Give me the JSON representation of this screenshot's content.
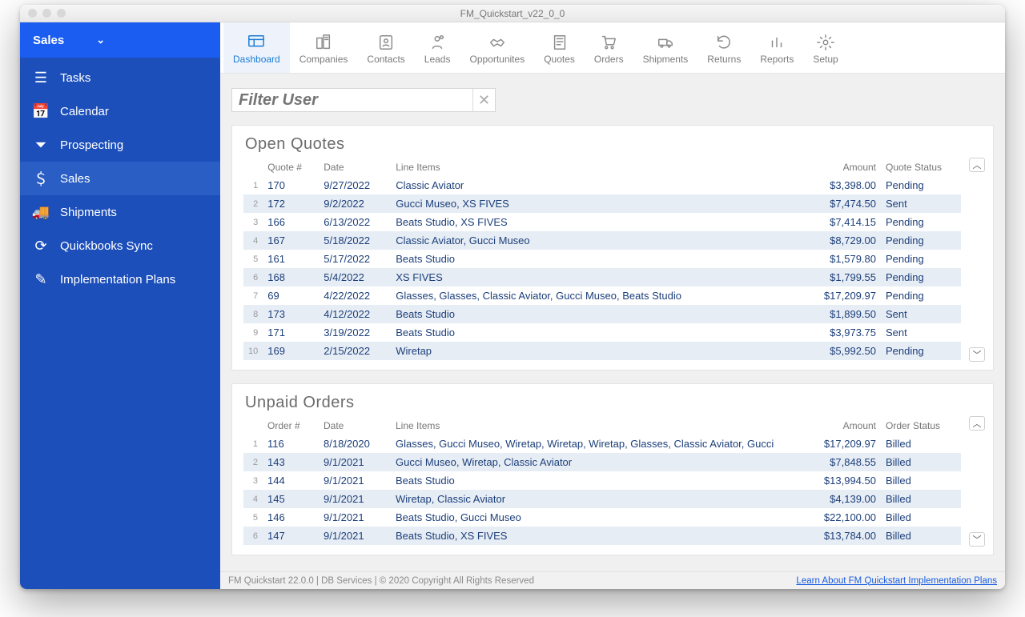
{
  "window_title": "FM_Quickstart_v22_0_0",
  "sidebar": {
    "header": "Sales",
    "items": [
      {
        "label": "Tasks",
        "icon": "list-icon"
      },
      {
        "label": "Calendar",
        "icon": "calendar-icon"
      },
      {
        "label": "Prospecting",
        "icon": "funnel-icon"
      },
      {
        "label": "Sales",
        "icon": "money-icon",
        "active": true
      },
      {
        "label": "Shipments",
        "icon": "truck-icon"
      },
      {
        "label": "Quickbooks Sync",
        "icon": "sync-icon"
      },
      {
        "label": "Implementation Plans",
        "icon": "pen-icon"
      }
    ]
  },
  "toolbar": [
    {
      "label": "Dashboard",
      "icon": "dashboard-icon",
      "active": true
    },
    {
      "label": "Companies",
      "icon": "buildings-icon"
    },
    {
      "label": "Contacts",
      "icon": "contacts-icon"
    },
    {
      "label": "Leads",
      "icon": "leads-icon"
    },
    {
      "label": "Opportunites",
      "icon": "handshake-icon"
    },
    {
      "label": "Quotes",
      "icon": "quotes-icon"
    },
    {
      "label": "Orders",
      "icon": "cart-icon"
    },
    {
      "label": "Shipments",
      "icon": "shipments-icon"
    },
    {
      "label": "Returns",
      "icon": "returns-icon"
    },
    {
      "label": "Reports",
      "icon": "reports-icon"
    },
    {
      "label": "Setup",
      "icon": "gear-icon"
    }
  ],
  "filter_placeholder": "Filter User",
  "quotes": {
    "title": "Open Quotes",
    "columns": [
      "Quote #",
      "Date",
      "Line Items",
      "Amount",
      "Quote Status"
    ],
    "rows": [
      {
        "n": "170",
        "date": "9/27/2022",
        "items": "Classic Aviator",
        "amount": "$3,398.00",
        "status": "Pending"
      },
      {
        "n": "172",
        "date": "9/2/2022",
        "items": "Gucci Museo, XS FIVES",
        "amount": "$7,474.50",
        "status": "Sent"
      },
      {
        "n": "166",
        "date": "6/13/2022",
        "items": "Beats Studio, XS FIVES",
        "amount": "$7,414.15",
        "status": "Pending"
      },
      {
        "n": "167",
        "date": "5/18/2022",
        "items": "Classic Aviator, Gucci Museo",
        "amount": "$8,729.00",
        "status": "Pending"
      },
      {
        "n": "161",
        "date": "5/17/2022",
        "items": "Beats Studio",
        "amount": "$1,579.80",
        "status": "Pending"
      },
      {
        "n": "168",
        "date": "5/4/2022",
        "items": "XS FIVES",
        "amount": "$1,799.55",
        "status": "Pending"
      },
      {
        "n": "69",
        "date": "4/22/2022",
        "items": "Glasses, Glasses, Classic Aviator, Gucci Museo, Beats Studio",
        "amount": "$17,209.97",
        "status": "Pending"
      },
      {
        "n": "173",
        "date": "4/12/2022",
        "items": "Beats Studio",
        "amount": "$1,899.50",
        "status": "Sent"
      },
      {
        "n": "171",
        "date": "3/19/2022",
        "items": "Beats Studio",
        "amount": "$3,973.75",
        "status": "Sent"
      },
      {
        "n": "169",
        "date": "2/15/2022",
        "items": "Wiretap",
        "amount": "$5,992.50",
        "status": "Pending"
      }
    ]
  },
  "orders": {
    "title": "Unpaid Orders",
    "columns": [
      "Order #",
      "Date",
      "Line Items",
      "Amount",
      "Order Status"
    ],
    "rows": [
      {
        "n": "116",
        "date": "8/18/2020",
        "items": "Glasses, Gucci Museo, Wiretap, Wiretap, Wiretap, Glasses, Classic Aviator, Gucci",
        "amount": "$17,209.97",
        "status": "Billed"
      },
      {
        "n": "143",
        "date": "9/1/2021",
        "items": "Gucci Museo, Wiretap, Classic Aviator",
        "amount": "$7,848.55",
        "status": "Billed"
      },
      {
        "n": "144",
        "date": "9/1/2021",
        "items": "Beats Studio",
        "amount": "$13,994.50",
        "status": "Billed"
      },
      {
        "n": "145",
        "date": "9/1/2021",
        "items": "Wiretap, Classic Aviator",
        "amount": "$4,139.00",
        "status": "Billed"
      },
      {
        "n": "146",
        "date": "9/1/2021",
        "items": "Beats Studio, Gucci Museo",
        "amount": "$22,100.00",
        "status": "Billed"
      },
      {
        "n": "147",
        "date": "9/1/2021",
        "items": "Beats Studio, XS FIVES",
        "amount": "$13,784.00",
        "status": "Billed"
      }
    ]
  },
  "footer_left": "FM Quickstart 22.0.0  | DB Services  | © 2020 Copyright All Rights Reserved",
  "footer_link": "Learn About FM Quickstart Implementation Plans"
}
